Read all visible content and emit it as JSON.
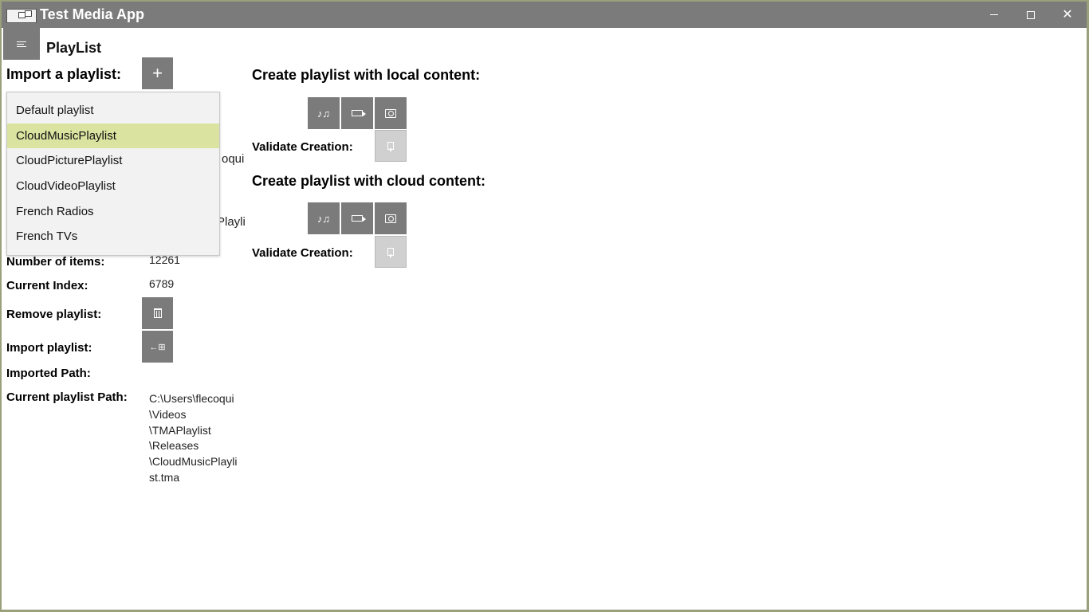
{
  "window": {
    "title": "Test Media App",
    "controls": {
      "minimize": "–",
      "maximize": "□",
      "close": "✕"
    }
  },
  "page": {
    "title": "PlayList"
  },
  "left": {
    "import_label": "Import a playlist:",
    "dropdown_items": [
      "Default playlist",
      "CloudMusicPlaylist",
      "CloudPicturePlaylist",
      "CloudVideoPlaylist",
      "French Radios",
      "French TVs"
    ],
    "selected_index": 1,
    "obscured_fragment_1": "oqui",
    "obscured_fragment_2": "Playli",
    "number_of_items_label": "Number of items:",
    "number_of_items": "12261",
    "current_index_label": "Current Index:",
    "current_index": "6789",
    "remove_label": "Remove playlist:",
    "import_playlist_label": "Import playlist:",
    "imported_path_label": "Imported Path:",
    "current_path_label": "Current playlist Path:",
    "current_path_lines": [
      "C:\\Users\\flecoqui",
      "\\Videos",
      "\\TMAPlaylist",
      "\\Releases",
      "\\CloudMusicPlayli",
      "st.tma"
    ]
  },
  "right": {
    "local_heading": "Create playlist with local content:",
    "cloud_heading": "Create playlist with cloud content:",
    "validate_label": "Validate Creation:"
  },
  "icons": {
    "add": "+",
    "music": "♪♫",
    "import": "←⊞"
  }
}
